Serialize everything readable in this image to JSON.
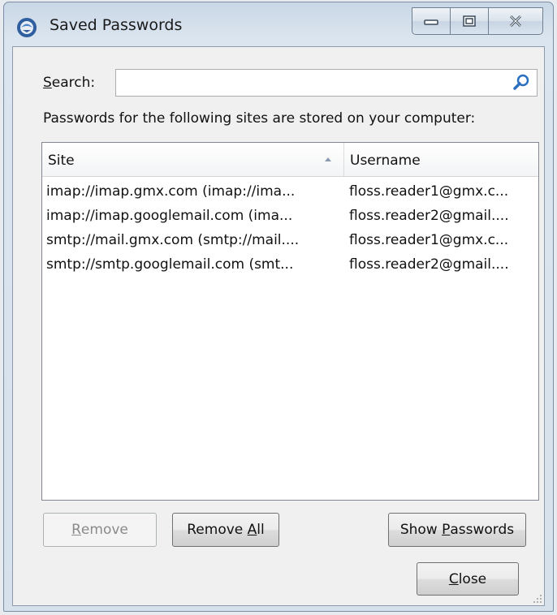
{
  "window": {
    "title": "Saved Passwords"
  },
  "search": {
    "label_mnemonic": "S",
    "label_rest": "earch:",
    "value": "",
    "placeholder": ""
  },
  "info_text": "Passwords for the following sites are stored on your computer:",
  "table": {
    "columns": {
      "site": "Site",
      "username": "Username"
    },
    "rows": [
      {
        "site": "imap://imap.gmx.com (imap://ima...",
        "username": "floss.reader1@gmx.c..."
      },
      {
        "site": "imap://imap.googlemail.com (ima...",
        "username": "floss.reader2@gmail...."
      },
      {
        "site": "smtp://mail.gmx.com (smtp://mail....",
        "username": "floss.reader1@gmx.c..."
      },
      {
        "site": "smtp://smtp.googlemail.com (smt...",
        "username": "floss.reader2@gmail...."
      }
    ]
  },
  "buttons": {
    "remove_mnemonic": "R",
    "remove_rest": "emove",
    "remove_all_pre": "Remove ",
    "remove_all_mnemonic": "A",
    "remove_all_post": "ll",
    "show_pre": "Show ",
    "show_mnemonic": "P",
    "show_post": "asswords",
    "close_mnemonic": "C",
    "close_rest": "lose"
  },
  "icons": {
    "app": "thunderbird-icon",
    "search": "search-icon",
    "minimize": "minimize-icon",
    "maximize": "maximize-icon",
    "close": "close-icon",
    "sort": "sort-ascending-icon"
  }
}
